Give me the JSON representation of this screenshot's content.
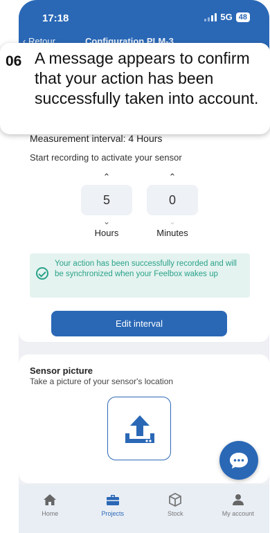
{
  "status_bar": {
    "time": "17:18",
    "network": "5G",
    "battery": "48"
  },
  "nav": {
    "back_label": "Retour",
    "title": "Configuration PLM-3"
  },
  "callout": {
    "step": "06",
    "text": "A message appears to confirm that your action has been successfully taken into account."
  },
  "interval": {
    "title": "Measurement interval: 4 Hours",
    "start_text": "Start recording to activate your sensor",
    "hours": {
      "value": "5",
      "label": "Hours"
    },
    "minutes": {
      "value": "0",
      "label": "Minutes"
    },
    "success_message": "Your action has been successfully recorded and will be synchronized when your Feelbox wakes up",
    "edit_button": "Edit interval"
  },
  "sensor_picture": {
    "title": "Sensor picture",
    "subtitle": "Take a picture of your sensor's location"
  },
  "tabbar": {
    "items": [
      {
        "label": "Home",
        "icon": "home-icon",
        "active": false
      },
      {
        "label": "Projects",
        "icon": "briefcase-icon",
        "active": true
      },
      {
        "label": "Stock",
        "icon": "box-icon",
        "active": false
      },
      {
        "label": "My account",
        "icon": "person-icon",
        "active": false
      }
    ]
  },
  "colors": {
    "primary": "#2a68b6",
    "success": "#2aa18a",
    "success_bg": "#e4f3ef"
  }
}
